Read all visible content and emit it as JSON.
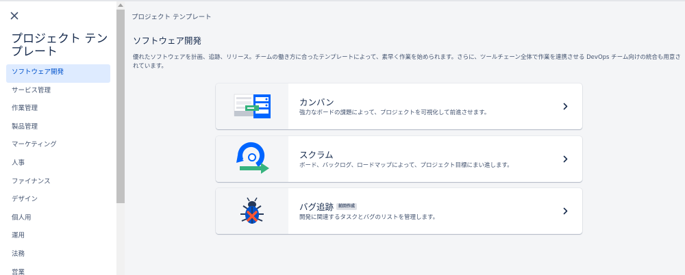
{
  "sidebar": {
    "title": "プロジェクト テンプレート",
    "items": [
      {
        "label": "ソフトウェア開発",
        "active": true
      },
      {
        "label": "サービス管理"
      },
      {
        "label": "作業管理"
      },
      {
        "label": "製品管理"
      },
      {
        "label": "マーケティング"
      },
      {
        "label": "人事"
      },
      {
        "label": "ファイナンス"
      },
      {
        "label": "デザイン"
      },
      {
        "label": "個人用"
      },
      {
        "label": "運用"
      },
      {
        "label": "法務"
      },
      {
        "label": "営業"
      }
    ]
  },
  "main": {
    "breadcrumb": "プロジェクト テンプレート",
    "section_title": "ソフトウェア開発",
    "description": "優れたソフトウェアを計画、追跡、リリース。チームの働き方に合ったテンプレートによって、素早く作業を始められます。さらに、ツールチェーン全体で作業を連携させる DevOps チーム向けの統合も用意されています。",
    "templates": [
      {
        "title": "カンバン",
        "description": "強力なボードの課題によって、プロジェクトを可視化して前進させます。",
        "icon": "kanban-board-illustration"
      },
      {
        "title": "スクラム",
        "description": "ボード、バックログ、ロードマップによって、プロジェクト目標にまい進します。",
        "icon": "scrum-cycle-illustration"
      },
      {
        "title": "バグ追跡",
        "badge": "前回作成",
        "description": "開発に関連するタスクとバグのリストを管理します。",
        "icon": "bug-illustration"
      }
    ]
  },
  "colors": {
    "accent": "#0052cc",
    "active_bg": "#deebff",
    "green": "#36b37e",
    "red": "#ff5630"
  }
}
